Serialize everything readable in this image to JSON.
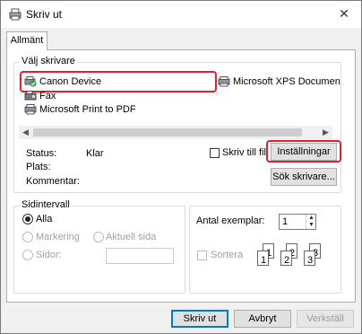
{
  "window": {
    "title": "Skriv ut",
    "close_glyph": "✕"
  },
  "tabs": [
    {
      "label": "Allmänt"
    }
  ],
  "select_printer": {
    "group_title": "Välj skrivare",
    "printers": [
      {
        "name": "Canon Device",
        "icon": "printer-default-icon",
        "selected": true
      },
      {
        "name": "Microsoft XPS Documen",
        "icon": "printer-icon"
      },
      {
        "name": "Fax",
        "icon": "fax-icon"
      },
      {
        "name": "Microsoft Print to PDF",
        "icon": "printer-icon"
      }
    ],
    "status_label": "Status:",
    "status_value": "Klar",
    "location_label": "Plats:",
    "comment_label": "Kommentar:",
    "print_to_file_label": "Skriv till fil",
    "preferences_button": "Inställningar",
    "find_printer_button": "Sök skrivare..."
  },
  "page_range": {
    "group_title": "Sidintervall",
    "options": [
      {
        "label": "Alla",
        "checked": true,
        "enabled": true
      },
      {
        "label": "Markering",
        "checked": false,
        "enabled": false
      },
      {
        "label": "Aktuell sida",
        "checked": false,
        "enabled": false
      },
      {
        "label": "Sidor:",
        "checked": false,
        "enabled": false
      }
    ]
  },
  "copies": {
    "label": "Antal exemplar:",
    "value": "1",
    "collate_label": "Sortera",
    "collate_page_numbers": [
      "1",
      "1",
      "2",
      "2",
      "3",
      "3"
    ]
  },
  "footer": {
    "print_button": "Skriv ut",
    "cancel_button": "Avbryt",
    "apply_button": "Verkställ"
  },
  "colors": {
    "highlight": "#e31f2c",
    "accent": "#0078d7"
  }
}
